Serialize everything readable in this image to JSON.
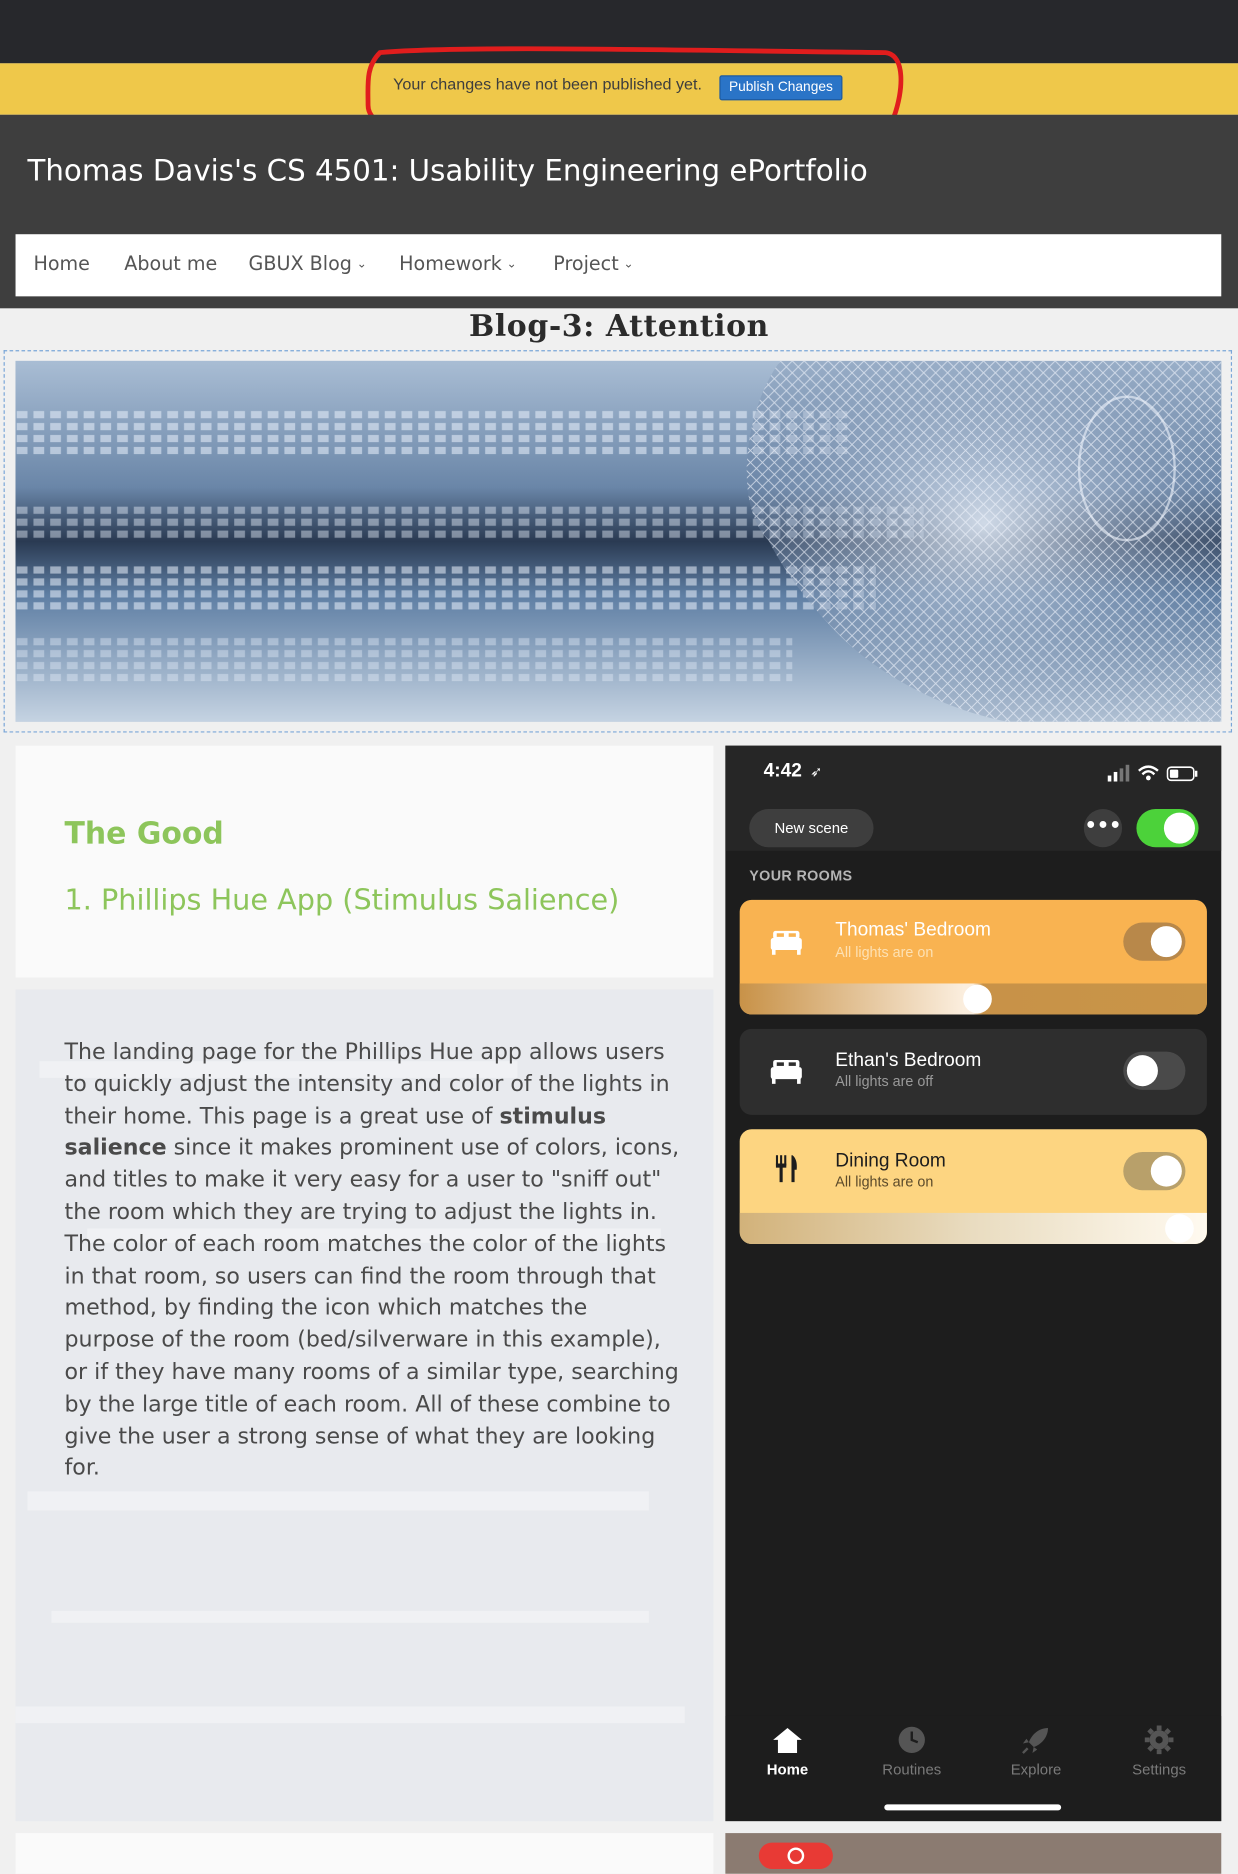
{
  "publish_bar": {
    "message": "Your changes have not been published yet.",
    "button_label": "Publish Changes"
  },
  "site": {
    "title": "Thomas Davis's CS 4501: Usability Engineering ePortfolio"
  },
  "nav": {
    "items": [
      {
        "label": "Home",
        "has_dropdown": false
      },
      {
        "label": "About me",
        "has_dropdown": false
      },
      {
        "label": "GBUX Blog",
        "has_dropdown": true
      },
      {
        "label": "Homework",
        "has_dropdown": true
      },
      {
        "label": "Project",
        "has_dropdown": true
      }
    ],
    "dropdown_glyph": "⌄"
  },
  "page": {
    "title": "Blog-3: Attention"
  },
  "good": {
    "heading": "The Good",
    "subheading": "1. Phillips Hue App (Stimulus Salience)"
  },
  "body": {
    "text_before": "The landing page for the Phillips Hue app allows users to quickly adjust the intensity and color of the lights in their home. This page is a great use of ",
    "bold": "stimulus salience",
    "text_after": " since it makes prominent use of colors, icons, and titles to make it very easy for a user to \"sniff out\" the room which they are trying to adjust the lights in. The color of each room matches the color of the lights in that room, so users can find the room through that method, by finding the icon which matches the purpose of the room (bed/silverware in this example), or if they have many rooms of a similar type, searching by the large title of each room. All of these combine to give the user a strong sense of what they are looking for."
  },
  "phone": {
    "time": "4:42",
    "location_glyph": "➶",
    "new_scene_label": "New scene",
    "more_glyph": "•••",
    "master_on": true,
    "section_label": "YOUR ROOMS",
    "rooms": [
      {
        "name": "Thomas' Bedroom",
        "status": "All lights are on",
        "icon": "bed-icon",
        "on": true,
        "brightness": 0.51,
        "color": "#f9b351"
      },
      {
        "name": "Ethan's Bedroom",
        "status": "All lights are off",
        "icon": "bed-icon",
        "on": false,
        "color": "#2e2e2e"
      },
      {
        "name": "Dining Room",
        "status": "All lights are on",
        "icon": "dining-icon",
        "on": true,
        "brightness": 0.97,
        "color": "#fdd581"
      }
    ],
    "tabs": [
      {
        "label": "Home",
        "icon": "home-icon",
        "active": true
      },
      {
        "label": "Routines",
        "icon": "clock-icon",
        "active": false
      },
      {
        "label": "Explore",
        "icon": "rocket-icon",
        "active": false
      },
      {
        "label": "Settings",
        "icon": "gear-icon",
        "active": false
      }
    ]
  },
  "colors": {
    "publish_bar": "#efc84a",
    "publish_button": "#2a74c7",
    "header_bg": "#3e3e3e",
    "accent_green": "#8dc55b",
    "toggle_on": "#4cd23a"
  }
}
